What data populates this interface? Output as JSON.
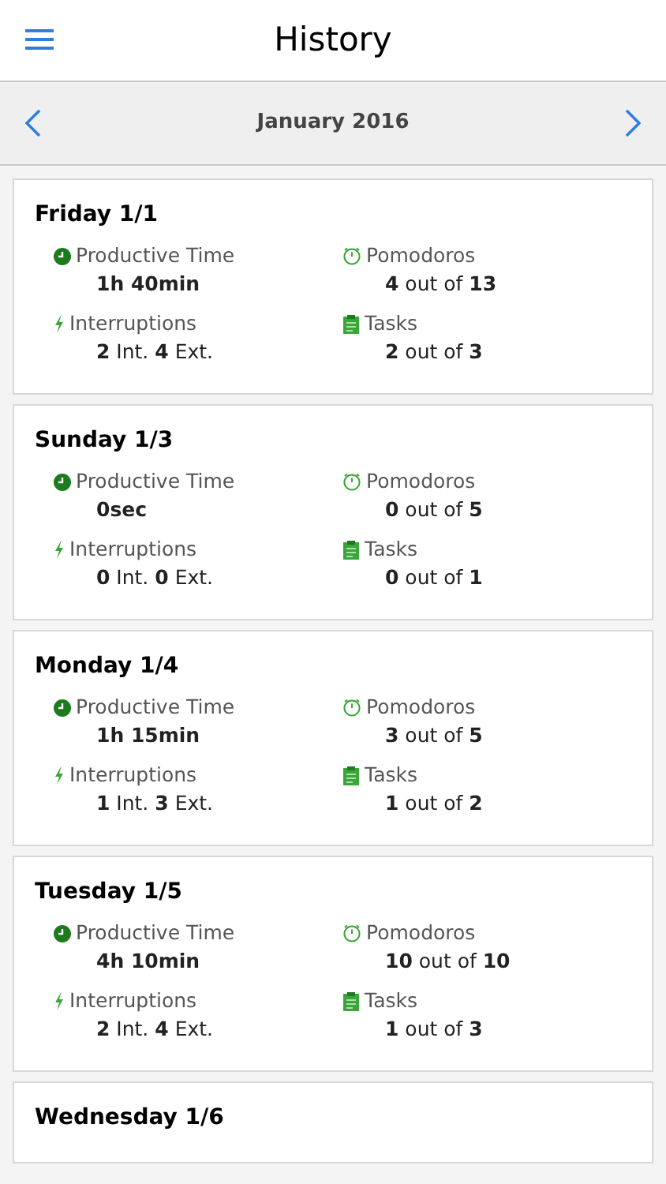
{
  "header": {
    "title": "History"
  },
  "month_bar": {
    "label": "January 2016"
  },
  "days": [
    {
      "title": "Friday 1/1",
      "productive_label": "Productive Time",
      "productive": "1h 40min",
      "pomodoros_label": "Pomodoros",
      "pomodoros": "**4** out of **13**",
      "interruptions_label": "Interruptions",
      "interruptions": "**2** Int. **4** Ext.",
      "tasks_label": "Tasks",
      "tasks": "**2** out of **3**"
    },
    {
      "title": "Sunday 1/3",
      "productive_label": "Productive Time",
      "productive": "0sec",
      "pomodoros_label": "Pomodoros",
      "pomodoros": "**0** out of **5**",
      "interruptions_label": "Interruptions",
      "interruptions": "**0** Int. **0** Ext.",
      "tasks_label": "Tasks",
      "tasks": "**0** out of **1**"
    },
    {
      "title": "Monday 1/4",
      "productive_label": "Productive Time",
      "productive": "1h 15min",
      "pomodoros_label": "Pomodoros",
      "pomodoros": "**3** out of **5**",
      "interruptions_label": "Interruptions",
      "interruptions": "**1** Int. **3** Ext.",
      "tasks_label": "Tasks",
      "tasks": "**1** out of **2**"
    },
    {
      "title": "Tuesday 1/5",
      "productive_label": "Productive Time",
      "productive": "4h 10min",
      "pomodoros_label": "Pomodoros",
      "pomodoros": "**10** out of **10**",
      "interruptions_label": "Interruptions",
      "interruptions": "**2** Int. **4** Ext.",
      "tasks_label": "Tasks",
      "tasks": "**1** out of **3**"
    },
    {
      "title": "Wednesday 1/6"
    }
  ]
}
